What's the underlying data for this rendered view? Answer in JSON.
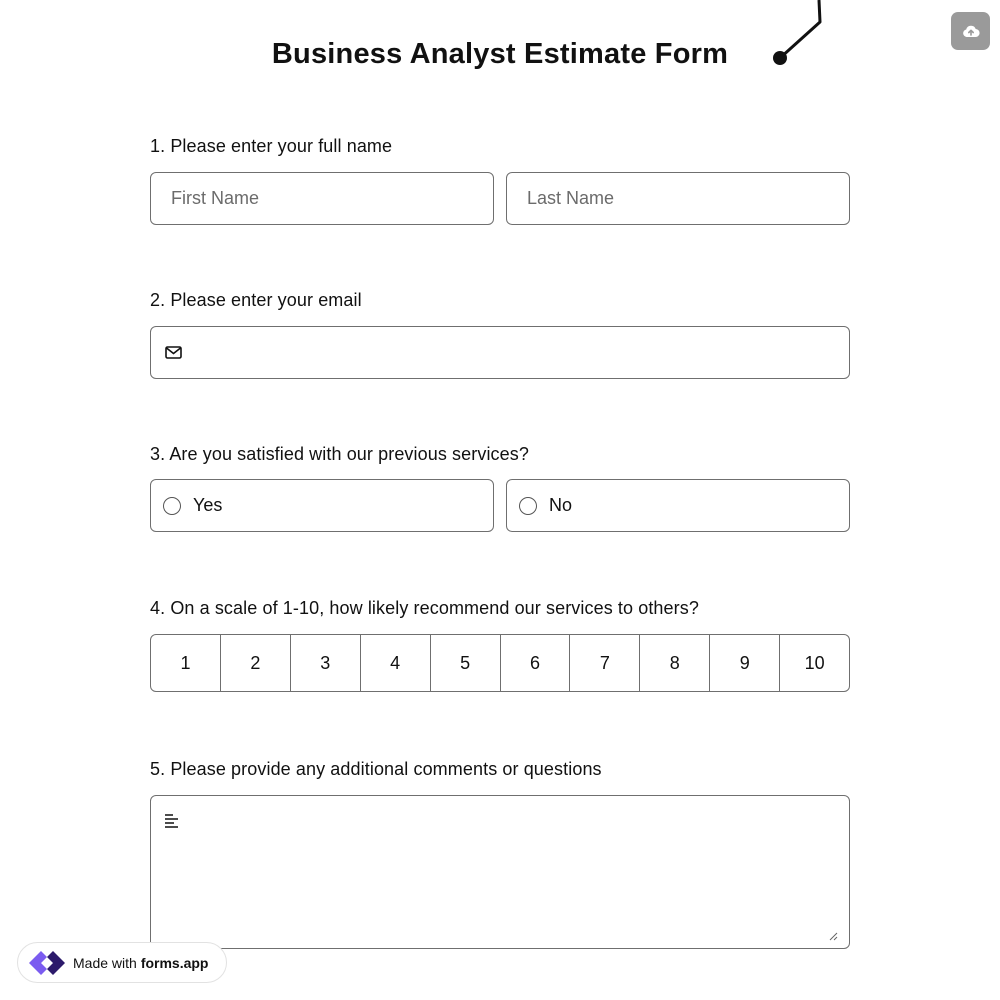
{
  "form": {
    "title": "Business Analyst Estimate Form"
  },
  "questions": {
    "q1": {
      "label": "1.  Please enter your full name",
      "first_name_placeholder": "First Name",
      "last_name_placeholder": "Last Name"
    },
    "q2": {
      "label": "2. Please enter your email",
      "email_value": ""
    },
    "q3": {
      "label": "3. Are you satisfied with our previous services?",
      "options": [
        "Yes",
        "No"
      ]
    },
    "q4": {
      "label": "4. On a scale of 1-10, how likely recommend our services to others?",
      "scale": [
        "1",
        "2",
        "3",
        "4",
        "5",
        "6",
        "7",
        "8",
        "9",
        "10"
      ]
    },
    "q5": {
      "label": "5. Please provide any additional comments or questions",
      "comment_value": ""
    }
  },
  "badge": {
    "prefix": "Made with",
    "brand": "forms.app"
  },
  "icons": {
    "upload": "cloud-upload-icon",
    "email": "envelope-icon",
    "textarea": "text-align-left-icon",
    "logo": "forms-app-logo-icon"
  },
  "colors": {
    "upload_button_bg": "#9a9a9a",
    "border": "#6f6f6f",
    "logo_purple": "#7b5cf0",
    "logo_dark": "#2c1a6b"
  }
}
